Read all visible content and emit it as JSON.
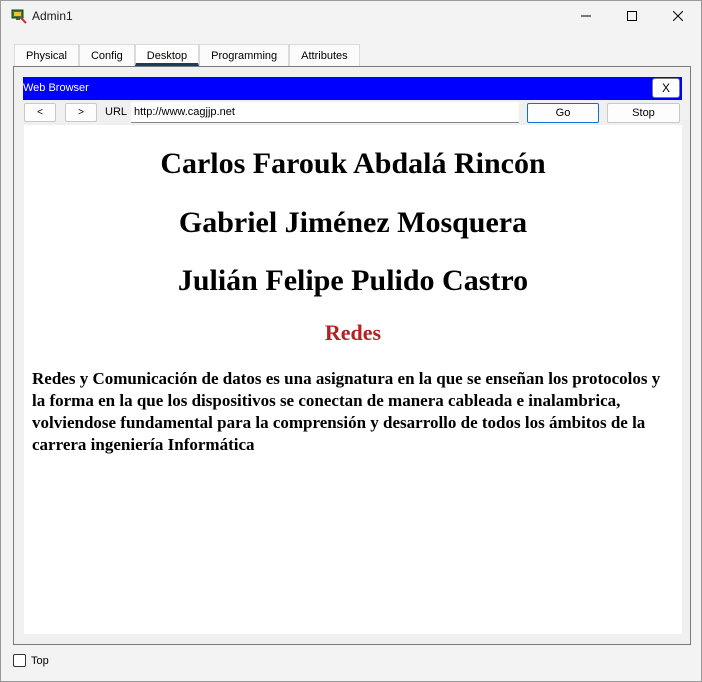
{
  "window": {
    "title": "Admin1",
    "icon": "packet-tracer-pc-icon"
  },
  "tabs": [
    {
      "label": "Physical",
      "active": false
    },
    {
      "label": "Config",
      "active": false
    },
    {
      "label": "Desktop",
      "active": true
    },
    {
      "label": "Programming",
      "active": false
    },
    {
      "label": "Attributes",
      "active": false
    }
  ],
  "browser": {
    "title": "Web Browser",
    "close_label": "X",
    "back_label": "<",
    "forward_label": ">",
    "url_label": "URL",
    "url_value": "http://www.cagjjp.net",
    "go_label": "Go",
    "stop_label": "Stop",
    "header_color": "#0000ff"
  },
  "page": {
    "names": [
      "Carlos Farouk Abdalá Rincón",
      "Gabriel Jiménez Mosquera",
      "Julián Felipe Pulido Castro"
    ],
    "subtitle": "Redes",
    "subtitle_color": "#b22222",
    "paragraph": "Redes y Comunicación de datos es una asignatura en la que se enseñan los protocolos y la forma en la que los dispositivos se conectan de manera cableada e inalambrica, volviendose fundamental para la comprensión y desarrollo de todos los ámbitos de la carrera ingeniería Informática"
  },
  "footer": {
    "top_label": "Top",
    "top_checked": false
  }
}
